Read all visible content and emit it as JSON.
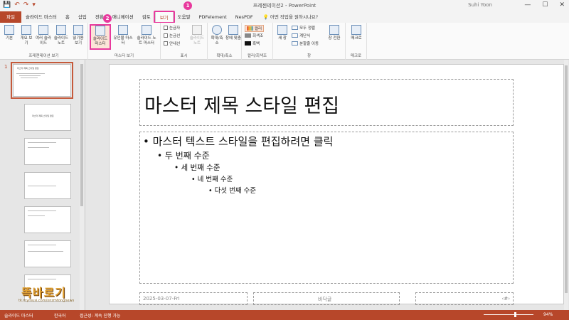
{
  "window": {
    "doc_title": "프레젠테이션2 - PowerPoint",
    "user": "Suhi Yoon",
    "min": "—",
    "max": "☐",
    "close": "✕"
  },
  "qat": {
    "save": "💾",
    "undo": "↶",
    "redo": "↷",
    "custom": "▾"
  },
  "tabs": [
    "파일",
    "슬라이드 마스터",
    "홈",
    "삽입",
    "전환",
    "애니메이션",
    "검토",
    "보기",
    "도움말",
    "PDFelement",
    "NesPDF"
  ],
  "tell_me": "어떤 작업을 원하시나요?",
  "badges": {
    "one": "1",
    "two": "2"
  },
  "ribbon": {
    "presentation_views": {
      "label": "프레젠테이션 보기",
      "buttons": [
        "기본",
        "개요 보기",
        "여러 슬라이드",
        "슬라이드 노트",
        "읽기용 보기"
      ]
    },
    "master_views": {
      "label": "마스터 보기",
      "buttons": [
        "슬라이드 마스터",
        "유인물 마스터",
        "슬라이드 노트 마스터"
      ]
    },
    "show": {
      "label": "표시",
      "checks": [
        "눈금자",
        "눈금선",
        "안내선"
      ],
      "notes": "슬라이드 노트"
    },
    "zoom": {
      "label": "확대/축소",
      "buttons": [
        "확대/축소",
        "창에 맞춤"
      ]
    },
    "color": {
      "label": "컬러/회색조",
      "items": [
        "컬러",
        "회색조",
        "흑백"
      ]
    },
    "window": {
      "label": "창",
      "new": "새 창",
      "items": [
        "모두 정렬",
        "계단식",
        "분할줄 이동"
      ],
      "switch": "창 전환"
    },
    "macros": {
      "label": "매크로",
      "button": "매크로"
    }
  },
  "thumbnails": {
    "slide_no": "1",
    "master_title": "마스터 제목 스타일 편집",
    "layout_title": "마스터 제목 스타일 편집"
  },
  "slide": {
    "title": "마스터 제목 스타일 편집",
    "levels": [
      "마스터 텍스트 스타일을 편집하려면 클릭",
      "두 번째 수준",
      "세 번째 수준",
      "네 번째 수준",
      "다섯 번째 수준"
    ],
    "date": "2025-03-07-Fri",
    "footer": "바닥글",
    "number": "‹#›"
  },
  "status": {
    "mode": "슬라이드 마스터",
    "lang": "한국어",
    "accessibility": "접근성: 계속 진행 가능",
    "zoom": "94%"
  },
  "watermark": {
    "main": "똑바로기",
    "sub": "tk.mymusi.com/xnzmtongnews"
  }
}
